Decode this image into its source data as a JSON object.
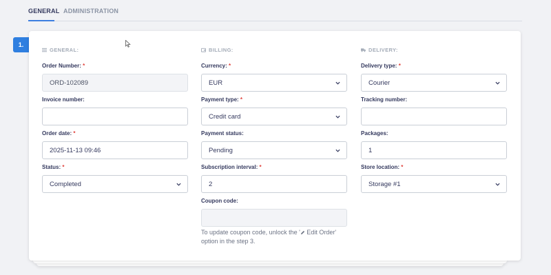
{
  "tabs": {
    "general": "GENERAL",
    "administration": "ADMINISTRATION"
  },
  "step": {
    "number": "1."
  },
  "sections": {
    "general": {
      "title": "GENERAL:",
      "order_number": {
        "label": "Order Number:",
        "required": "*",
        "value": "ORD-102089"
      },
      "invoice_number": {
        "label": "Invoice number:",
        "value": ""
      },
      "order_date": {
        "label": "Order date:",
        "required": "*",
        "value": "2025-11-13 09:46"
      },
      "status": {
        "label": "Status:",
        "required": "*",
        "value": "Completed"
      }
    },
    "billing": {
      "title": "BILLING:",
      "currency": {
        "label": "Currency:",
        "required": "*",
        "value": "EUR"
      },
      "payment_type": {
        "label": "Payment type:",
        "required": "*",
        "value": "Credit card"
      },
      "payment_status": {
        "label": "Payment status:",
        "value": "Pending"
      },
      "subscription_interval": {
        "label": "Subscription interval:",
        "required": "*",
        "value": "2"
      },
      "coupon_code": {
        "label": "Coupon code:",
        "value": ""
      },
      "hint_part1": "To update coupon code, unlock the '",
      "hint_part2": " Edit Order'",
      "hint_part3": "option in the step 3."
    },
    "delivery": {
      "title": "DELIVERY:",
      "delivery_type": {
        "label": "Delivery type:",
        "required": "*",
        "value": "Courier"
      },
      "tracking_number": {
        "label": "Tracking number:",
        "value": ""
      },
      "packages": {
        "label": "Packages:",
        "value": "1"
      },
      "store_location": {
        "label": "Store location:",
        "required": "*",
        "value": "Storage #1"
      }
    }
  },
  "colors": {
    "accent": "#2f7fe0",
    "required": "#e0413b",
    "text": "#34395e",
    "muted": "#a4acb8"
  },
  "icons": {
    "general": "list-icon",
    "billing": "wallet-icon",
    "delivery": "truck-icon",
    "select": "chevron-down-icon",
    "hint": "pencil-icon"
  }
}
